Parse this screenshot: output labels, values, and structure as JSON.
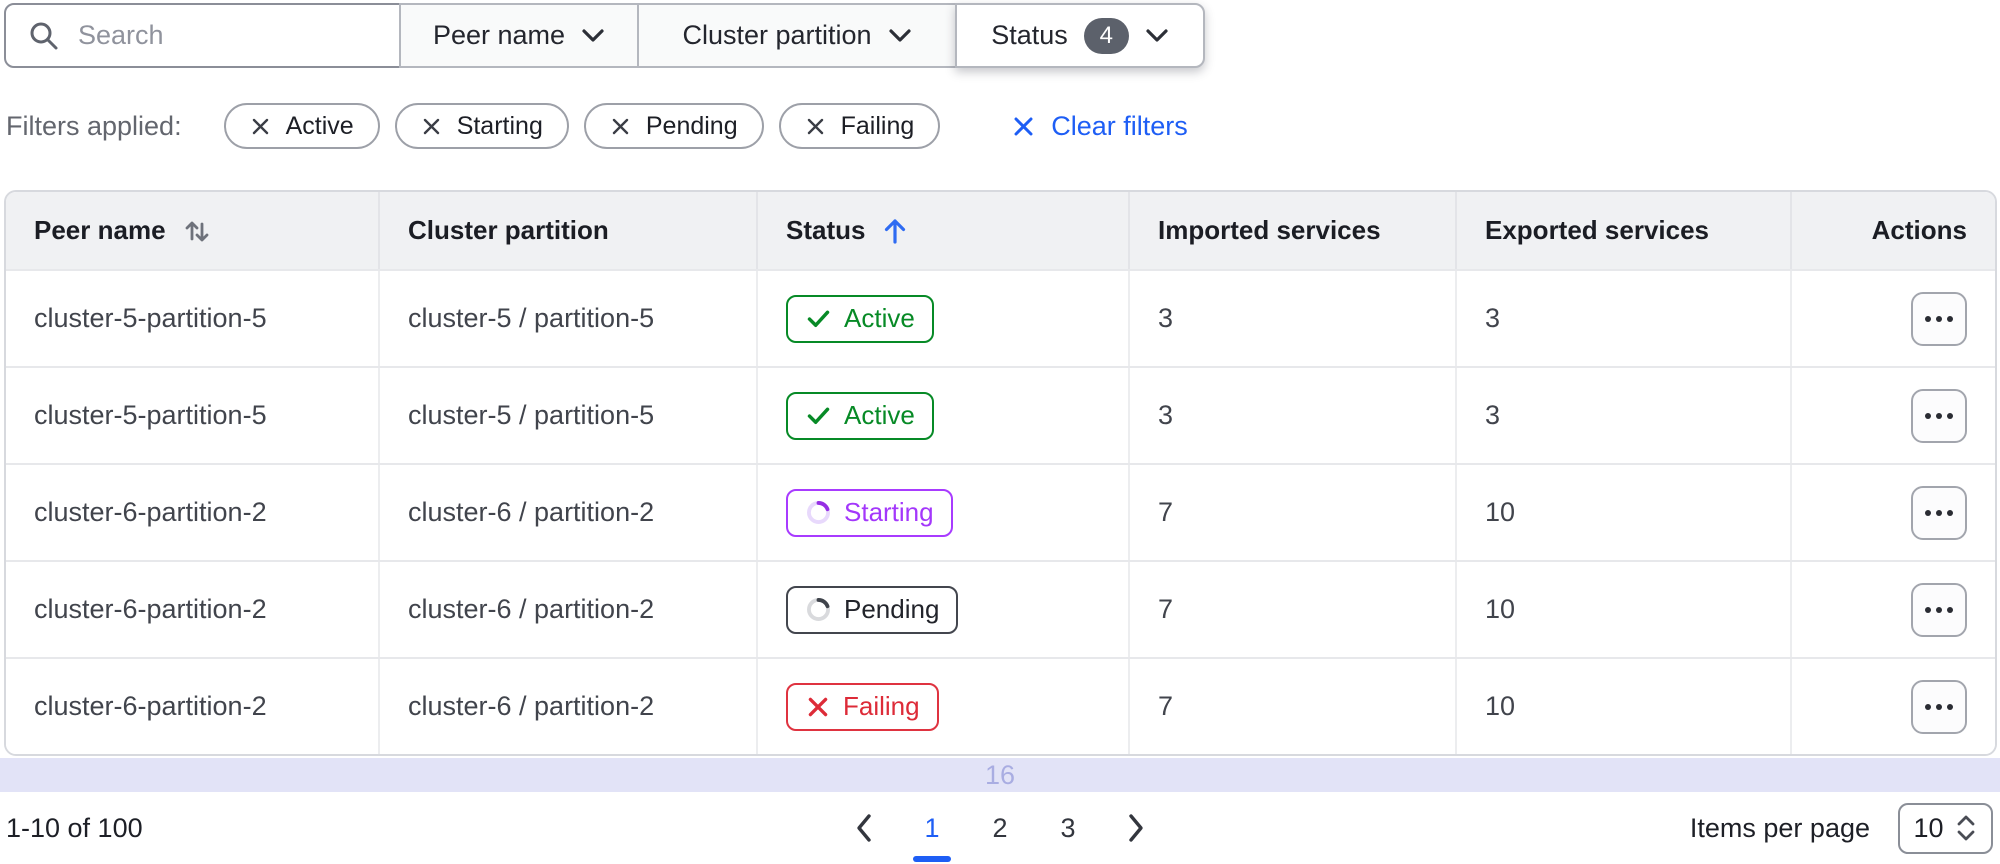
{
  "toolbar": {
    "search": {
      "placeholder": "Search"
    },
    "filters": [
      {
        "label": "Peer name"
      },
      {
        "label": "Cluster partition"
      },
      {
        "label": "Status",
        "count": "4"
      }
    ]
  },
  "filters_applied": {
    "label": "Filters applied:",
    "chips": [
      "Active",
      "Starting",
      "Pending",
      "Failing"
    ],
    "clear_label": "Clear filters"
  },
  "table": {
    "columns": [
      {
        "label": "Peer name",
        "sort": "both"
      },
      {
        "label": "Cluster partition",
        "sort": "none"
      },
      {
        "label": "Status",
        "sort": "asc"
      },
      {
        "label": "Imported services",
        "sort": "none"
      },
      {
        "label": "Exported services",
        "sort": "none"
      },
      {
        "label": "Actions",
        "sort": "none"
      }
    ],
    "rows": [
      {
        "peer_name": "cluster-5-partition-5",
        "cluster_partition": "cluster-5 / partition-5",
        "status": "Active",
        "status_kind": "active",
        "imported": "3",
        "exported": "3"
      },
      {
        "peer_name": "cluster-5-partition-5",
        "cluster_partition": "cluster-5 / partition-5",
        "status": "Active",
        "status_kind": "active",
        "imported": "3",
        "exported": "3"
      },
      {
        "peer_name": "cluster-6-partition-2",
        "cluster_partition": "cluster-6 / partition-2",
        "status": "Starting",
        "status_kind": "starting",
        "imported": "7",
        "exported": "10"
      },
      {
        "peer_name": "cluster-6-partition-2",
        "cluster_partition": "cluster-6 / partition-2",
        "status": "Pending",
        "status_kind": "pending",
        "imported": "7",
        "exported": "10"
      },
      {
        "peer_name": "cluster-6-partition-2",
        "cluster_partition": "cluster-6 / partition-2",
        "status": "Failing",
        "status_kind": "failing",
        "imported": "7",
        "exported": "10"
      }
    ],
    "overflow_value": "16"
  },
  "pagination": {
    "range_label": "1-10 of 100",
    "pages": [
      "1",
      "2",
      "3"
    ],
    "current_page": "1",
    "items_per_page_label": "Items per page",
    "items_per_page_value": "10"
  },
  "colors": {
    "accent_blue": "#1e5ef5",
    "success_green": "#078a26",
    "starting_purple": "#a83bff",
    "failing_red": "#df3340",
    "pending_dark": "#43464e",
    "header_bg": "#f0f1f3",
    "overflow_band_bg": "#e2e3f7",
    "count_badge_bg": "#5c616b"
  }
}
